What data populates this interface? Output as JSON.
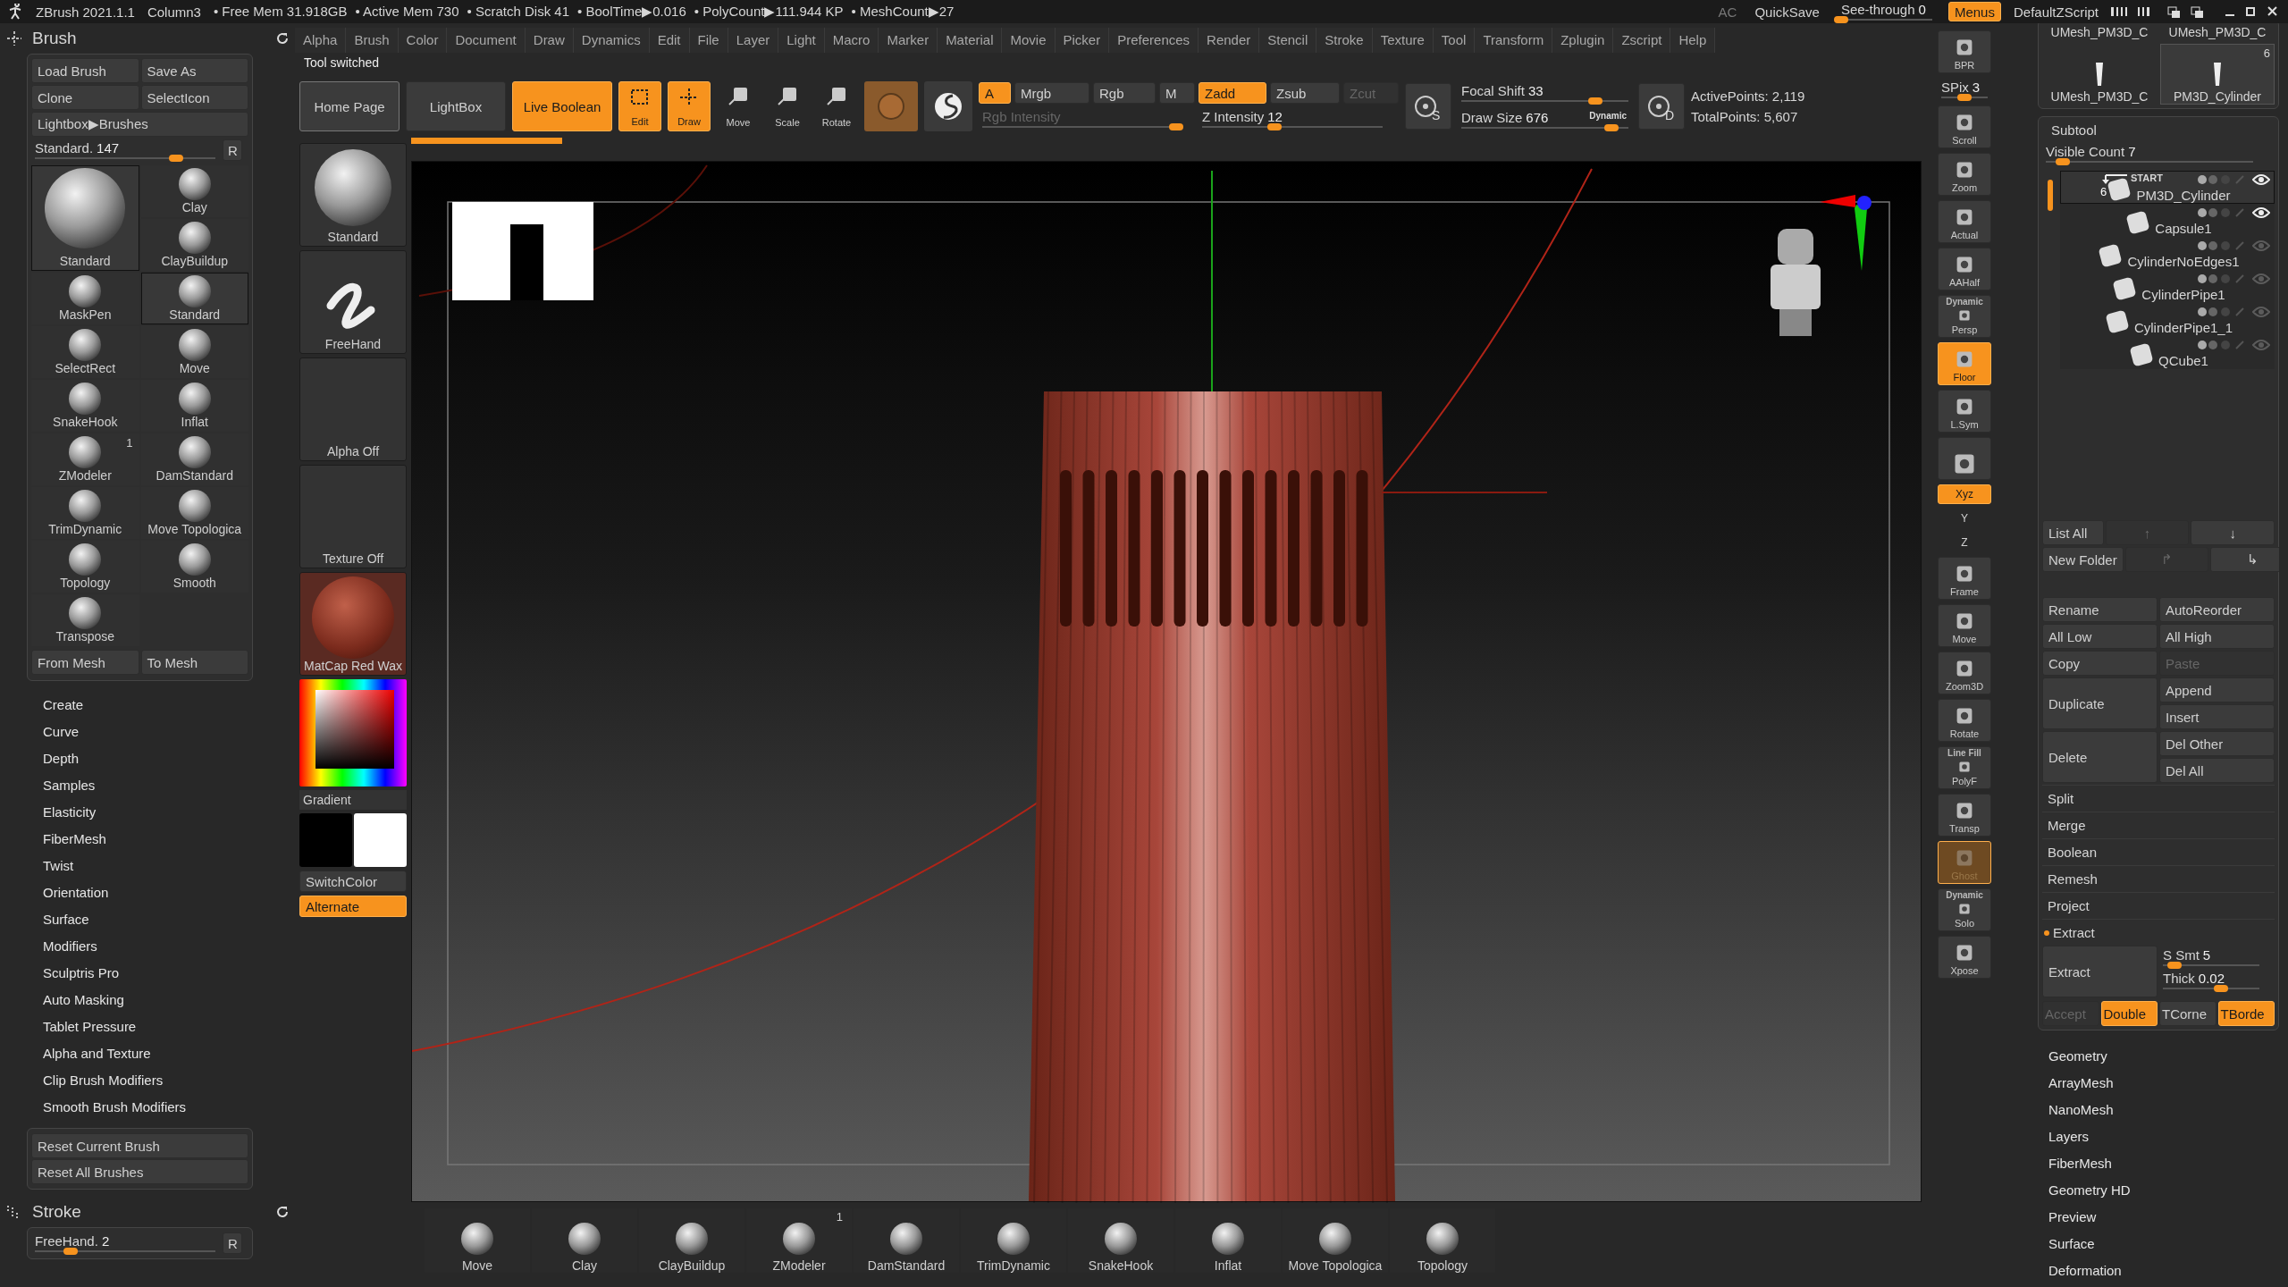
{
  "title_bar": {
    "app": "ZBrush 2021.1.1",
    "document": "Column3",
    "stats": [
      "• Free Mem 31.918GB",
      "• Active Mem 730",
      "• Scratch Disk 41",
      "• BoolTime▶0.016",
      "• PolyCount▶111.944 KP",
      "• MeshCount▶27"
    ],
    "ac": "AC",
    "quicksave": "QuickSave",
    "see_through": {
      "label": "See-through",
      "value": "0",
      "level": 0
    },
    "menus": {
      "label": "Menus",
      "on": true
    },
    "script": "DefaultZScript"
  },
  "brush_palette": {
    "title": "Brush",
    "buttons": [
      "Load Brush",
      "Save As",
      "Clone",
      "SelectIcon",
      "Lightbox▶Brushes"
    ],
    "slider": {
      "label": "Standard.",
      "value": "147",
      "level": 0.78
    },
    "reset_key": "R",
    "current_brush": {
      "label": "Standard",
      "selected": true
    },
    "brushes": [
      {
        "label": "Clay",
        "selected": false
      },
      {
        "label": "ClayBuildup",
        "selected": false
      },
      {
        "label": "MaskPen",
        "selected": false
      },
      {
        "label": "Standard",
        "selected": true
      },
      {
        "label": "SelectRect",
        "selected": false
      },
      {
        "label": "Move",
        "selected": false
      },
      {
        "label": "SnakeHook",
        "selected": false
      },
      {
        "label": "Inflat",
        "selected": false
      },
      {
        "label": "ZModeler",
        "selected": false,
        "badge": "1"
      },
      {
        "label": "DamStandard",
        "selected": false
      },
      {
        "label": "TrimDynamic",
        "selected": false
      },
      {
        "label": "Move Topologica",
        "selected": false
      },
      {
        "label": "Topology",
        "selected": false
      },
      {
        "label": "Smooth",
        "selected": false
      },
      {
        "label": "Transpose",
        "selected": false
      }
    ],
    "footer_buttons": [
      "From Mesh",
      "To Mesh"
    ]
  },
  "brush_sections": [
    "Create",
    "Curve",
    "Depth",
    "Samples",
    "Elasticity",
    "FiberMesh",
    "Twist",
    "Orientation",
    "Surface",
    "Modifiers",
    "Sculptris Pro",
    "Auto Masking",
    "Tablet Pressure",
    "Alpha and Texture",
    "Clip Brush Modifiers",
    "Smooth Brush Modifiers"
  ],
  "brush_reset": [
    "Reset Current Brush",
    "Reset All Brushes"
  ],
  "stroke_palette": {
    "title": "Stroke",
    "slider": {
      "label": "FreeHand.",
      "value": "2",
      "level": 0.2
    },
    "reset_key": "R"
  },
  "menu_bar": [
    "Alpha",
    "Brush",
    "Color",
    "Document",
    "Draw",
    "Dynamics",
    "Edit",
    "File",
    "Layer",
    "Light",
    "Macro",
    "Marker",
    "Material",
    "Movie",
    "Picker",
    "Preferences",
    "Render",
    "Stencil",
    "Stroke",
    "Texture",
    "Tool",
    "Transform",
    "Zplugin",
    "Zscript",
    "Help"
  ],
  "notification": "Tool switched",
  "progress": {
    "level": 0.1
  },
  "toolbar": {
    "nav": [
      {
        "label": "Home Page",
        "on": false
      },
      {
        "label": "LightBox",
        "on": false
      },
      {
        "label": "Live Boolean",
        "on": true
      }
    ],
    "modes": [
      {
        "label": "Edit",
        "on": true
      },
      {
        "label": "Draw",
        "on": true
      },
      {
        "label": "Move",
        "on": false
      },
      {
        "label": "Scale",
        "on": false
      },
      {
        "label": "Rotate",
        "on": false
      }
    ],
    "channels": [
      {
        "label": "A",
        "on": true
      },
      {
        "label": "Mrgb",
        "on": false
      },
      {
        "label": "Rgb",
        "on": false
      },
      {
        "label": "M",
        "on": false
      }
    ],
    "z_modes": [
      {
        "label": "Zadd",
        "on": true,
        "disabled": false
      },
      {
        "label": "Zsub",
        "on": false,
        "disabled": false
      },
      {
        "label": "Zcut",
        "on": false,
        "disabled": true
      }
    ],
    "rgb_intensity": {
      "label": "Rgb Intensity",
      "level": 0.97,
      "disabled": true
    },
    "z_intensity": {
      "label": "Z Intensity",
      "value": "12",
      "level": 0.4
    },
    "focal_button": "S",
    "focal_shift": {
      "label": "Focal Shift",
      "value": "33",
      "level": 0.8
    },
    "draw_size": {
      "label": "Draw Size",
      "value": "676",
      "level": 0.9,
      "note": "Dynamic"
    },
    "draw_button": "D",
    "points": [
      "ActivePoints: 2,119",
      "TotalPoints: 5,607"
    ]
  },
  "left_shelf": {
    "brush": "Standard",
    "stroke": "FreeHand",
    "alpha": "Alpha Off",
    "texture": "Texture Off",
    "material": "MatCap Red Wax",
    "gradient": "Gradient",
    "swatches": [
      {
        "color": "#000000"
      },
      {
        "color": "#ffffff"
      }
    ],
    "switch_color": "SwitchColor",
    "alternate": {
      "label": "Alternate",
      "on": true
    }
  },
  "bottom_shelf": [
    {
      "label": "Move"
    },
    {
      "label": "Clay"
    },
    {
      "label": "ClayBuildup"
    },
    {
      "label": "ZModeler",
      "badge": "1"
    },
    {
      "label": "DamStandard"
    },
    {
      "label": "TrimDynamic"
    },
    {
      "label": "SnakeHook"
    },
    {
      "label": "Inflat"
    },
    {
      "label": "Move Topologica"
    },
    {
      "label": "Topology"
    }
  ],
  "right_shelf": [
    {
      "kind": "button",
      "label": "BPR",
      "on": false,
      "disabled": false
    },
    {
      "kind": "slider",
      "label": "SPix",
      "value": "3",
      "level": 0.5
    },
    {
      "kind": "button",
      "label": "Scroll",
      "on": false,
      "disabled": false
    },
    {
      "kind": "button",
      "label": "Zoom",
      "on": false,
      "disabled": false
    },
    {
      "kind": "button",
      "label": "Actual",
      "on": false,
      "disabled": false
    },
    {
      "kind": "button",
      "label": "AAHalf",
      "on": false,
      "disabled": false
    },
    {
      "kind": "button",
      "caption": "Dynamic",
      "label": "Persp",
      "on": false,
      "disabled": false
    },
    {
      "kind": "button",
      "label": "Floor",
      "on": true,
      "disabled": false
    },
    {
      "kind": "button",
      "label": "L.Sym",
      "on": false,
      "disabled": false
    },
    {
      "kind": "icon",
      "on": false,
      "disabled": false
    },
    {
      "kind": "small",
      "label": "Xyz",
      "on": true,
      "disabled": false
    },
    {
      "kind": "small",
      "label": "Y",
      "on": false,
      "disabled": false
    },
    {
      "kind": "small",
      "label": "Z",
      "on": false,
      "disabled": false
    },
    {
      "kind": "button",
      "label": "Frame",
      "on": false,
      "disabled": false
    },
    {
      "kind": "button",
      "label": "Move",
      "on": false,
      "disabled": false
    },
    {
      "kind": "button",
      "label": "Zoom3D",
      "on": false,
      "disabled": false
    },
    {
      "kind": "button",
      "label": "Rotate",
      "on": false,
      "disabled": false
    },
    {
      "kind": "button",
      "caption": "Line Fill",
      "label": "PolyF",
      "on": false,
      "disabled": false
    },
    {
      "kind": "button",
      "label": "Transp",
      "on": false,
      "disabled": false
    },
    {
      "kind": "button",
      "label": "Ghost",
      "on": true,
      "disabled": true
    },
    {
      "kind": "button",
      "caption": "Dynamic",
      "label": "Solo",
      "on": false,
      "disabled": false
    },
    {
      "kind": "button",
      "label": "Xpose",
      "on": false,
      "disabled": false
    }
  ],
  "scrolled_thumbnails": [
    "UMesh_PM3D_C",
    "UMesh_PM3D_C"
  ],
  "tool_thumbnails": [
    {
      "label": "UMesh_PM3D_C",
      "selected": false
    },
    {
      "label": "PM3D_Cylinder",
      "count": "6",
      "selected": true
    }
  ],
  "subtool": {
    "title": "Subtool",
    "visible_count": {
      "label": "Visible Count",
      "value": "7",
      "level": 0.08
    },
    "items": [
      {
        "name": "PM3D_Cylinder",
        "selected": true,
        "visible": true,
        "count": "6",
        "marker": "START"
      },
      {
        "name": "Capsule1",
        "selected": false,
        "visible": true
      },
      {
        "name": "CylinderNoEdges1",
        "selected": false,
        "visible": false
      },
      {
        "name": "CylinderPipe1",
        "selected": false,
        "visible": false
      },
      {
        "name": "CylinderPipe1_1",
        "selected": false,
        "visible": false
      },
      {
        "name": "QCube1",
        "selected": false,
        "visible": false
      }
    ],
    "list_rows": [
      [
        {
          "label": "List All",
          "disabled": false
        },
        {
          "label": "↑",
          "disabled": true
        },
        {
          "label": "↓",
          "disabled": false
        }
      ],
      [
        {
          "label": "New Folder",
          "disabled": false
        },
        {
          "label": "↱",
          "disabled": true
        },
        {
          "label": "↳",
          "disabled": false
        }
      ]
    ],
    "actions": [
      {
        "label": "Rename",
        "disabled": false
      },
      {
        "label": "AutoReorder",
        "disabled": false
      },
      {
        "label": "All Low",
        "disabled": false
      },
      {
        "label": "All High",
        "disabled": false
      },
      {
        "label": "Copy",
        "disabled": false
      },
      {
        "label": "Paste",
        "disabled": true
      }
    ],
    "action_groups": [
      {
        "main": "Duplicate",
        "options": [
          "Append",
          "Insert"
        ]
      },
      {
        "main": "Delete",
        "options": [
          "Del Other",
          "Del All"
        ]
      }
    ],
    "sections": [
      "Split",
      "Merge",
      "Boolean",
      "Remesh",
      "Project"
    ],
    "extract": {
      "label": "Extract",
      "expanded": true,
      "button": "Extract",
      "s_smt": {
        "label": "S Smt",
        "value": "5",
        "level": 0.12
      },
      "thick": {
        "label": "Thick",
        "value": "0.02",
        "level": 0.6
      },
      "options": [
        {
          "label": "Accept",
          "on": false,
          "disabled": true
        },
        {
          "label": "Double",
          "on": true,
          "disabled": false
        },
        {
          "label": "TCorne",
          "on": false,
          "disabled": false
        },
        {
          "label": "TBorde",
          "on": true,
          "disabled": false
        }
      ]
    }
  },
  "tool_sections": [
    "Geometry",
    "ArrayMesh",
    "NanoMesh",
    "Layers",
    "FiberMesh",
    "Geometry HD",
    "Preview",
    "Surface",
    "Deformation"
  ]
}
